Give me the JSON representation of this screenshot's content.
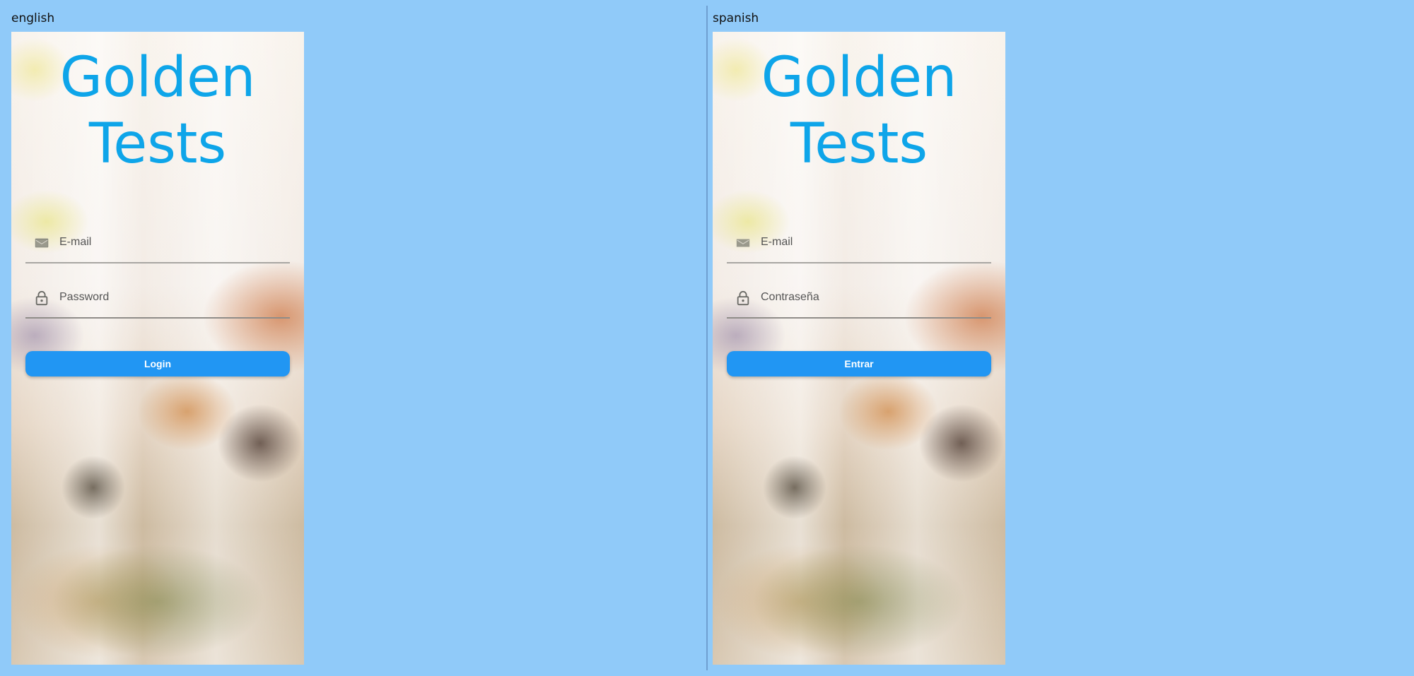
{
  "panels": [
    {
      "locale_label": "english",
      "title_line1": "Golden",
      "title_line2": "Tests",
      "email_placeholder": "E-mail",
      "password_placeholder": "Password",
      "button_label": "Login"
    },
    {
      "locale_label": "spanish",
      "title_line1": "Golden",
      "title_line2": "Tests",
      "email_placeholder": "E-mail",
      "password_placeholder": "Contraseña",
      "button_label": "Entrar"
    }
  ],
  "icons": {
    "email": "mail-icon",
    "password": "lock-icon"
  },
  "colors": {
    "page_background": "#90CAF9",
    "title": "#0EA5E9",
    "button": "#2196F3",
    "button_text": "#FFFFFF"
  }
}
